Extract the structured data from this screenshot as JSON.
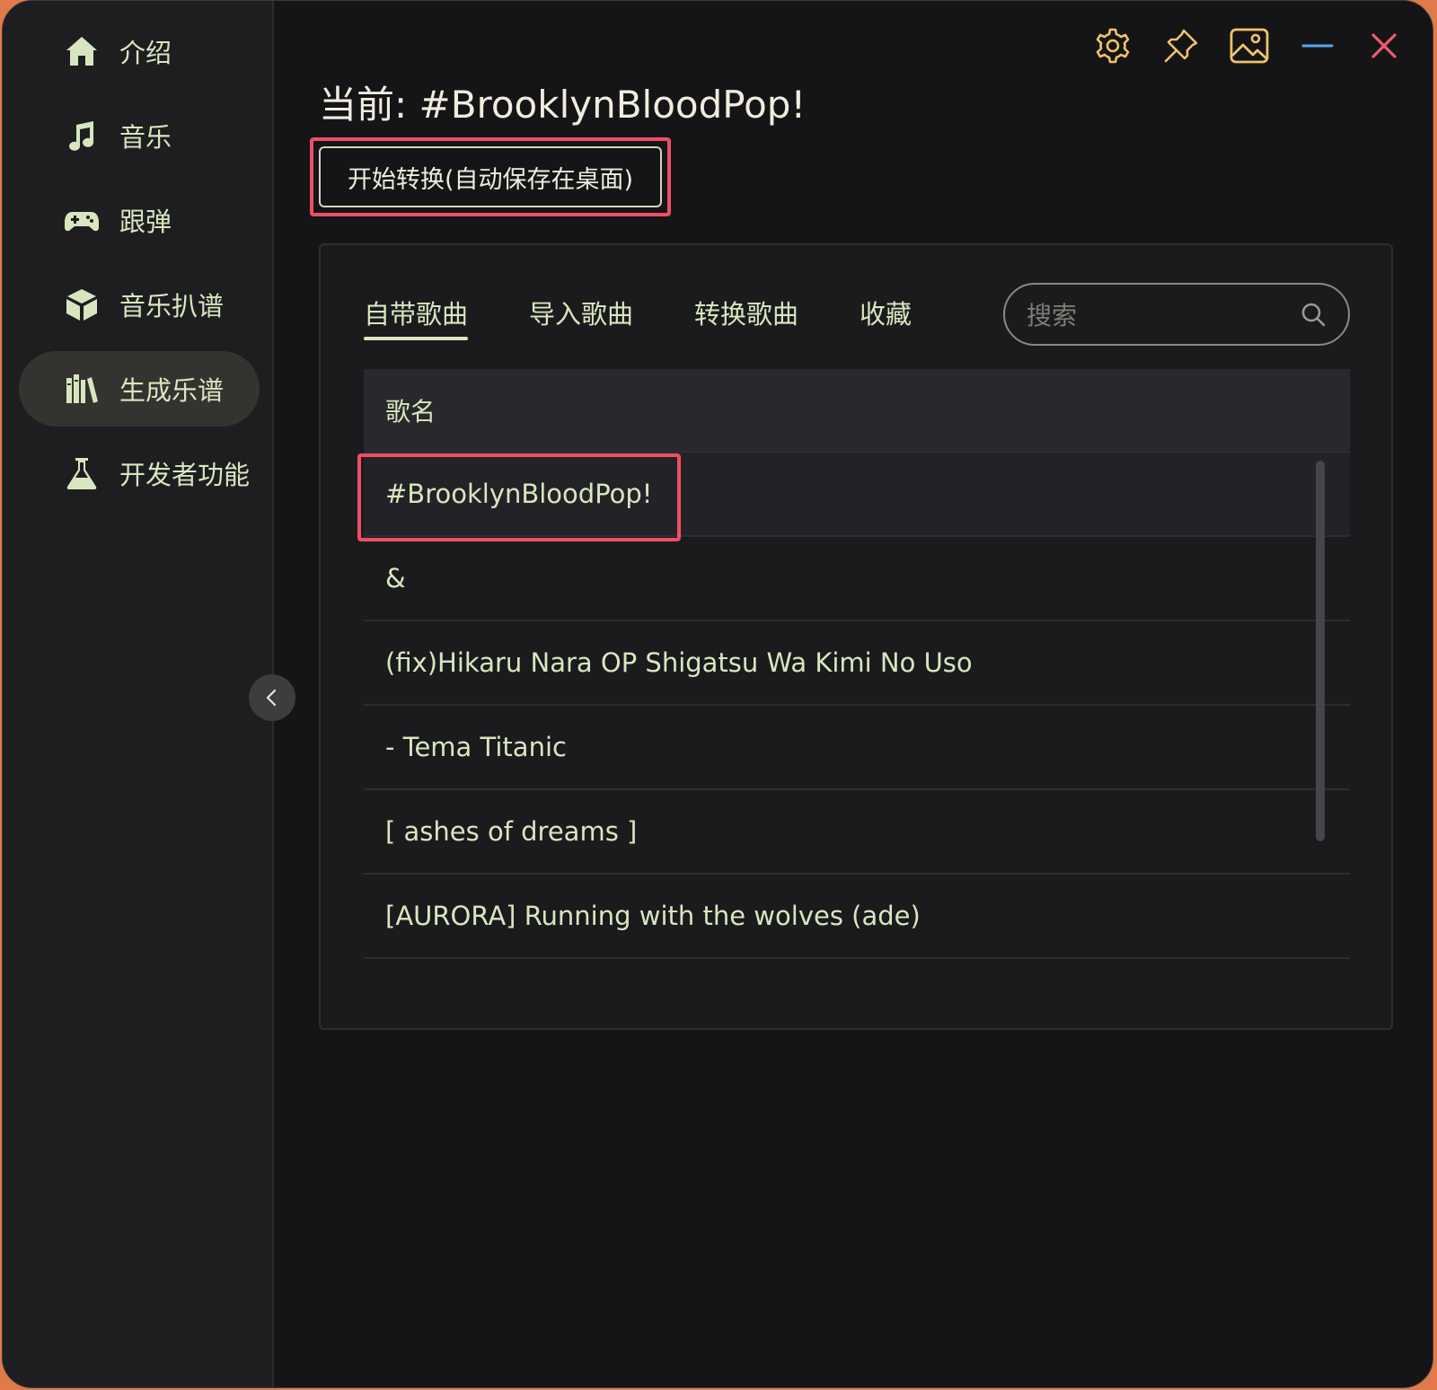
{
  "sidebar": {
    "items": [
      {
        "label": "介绍",
        "icon": "home-icon"
      },
      {
        "label": "音乐",
        "icon": "music-note-icon"
      },
      {
        "label": "跟弹",
        "icon": "gamepad-icon"
      },
      {
        "label": "音乐扒谱",
        "icon": "cube-icon"
      },
      {
        "label": "生成乐谱",
        "icon": "books-icon",
        "active": true
      },
      {
        "label": "开发者功能",
        "icon": "flask-icon"
      }
    ]
  },
  "titlebar": {
    "buttons": [
      "gear-icon",
      "pin-icon",
      "image-icon",
      "minimize-icon",
      "close-icon"
    ],
    "accent": "#f0c36a",
    "minimize_color": "#5aa6ef",
    "close_color": "#ee5a6e"
  },
  "main": {
    "title": "当前: #BrooklynBloodPop!",
    "convert_button": "开始转换(自动保存在桌面)",
    "tabs": [
      {
        "label": "自带歌曲",
        "active": true
      },
      {
        "label": "导入歌曲"
      },
      {
        "label": "转换歌曲"
      },
      {
        "label": "收藏"
      }
    ],
    "search": {
      "placeholder": "搜索"
    },
    "table": {
      "header": "歌名",
      "rows": [
        "#BrooklynBloodPop!",
        "&",
        "(fix)Hikaru Nara OP Shigatsu Wa Kimi No Uso",
        "- Tema Titanic",
        "[ ashes of dreams ]",
        "[AURORA] Running with the wolves (ade)"
      ],
      "selected_index": 0
    }
  },
  "colors": {
    "text": "#d8e6c0",
    "highlight": "#ee4f66",
    "background": "#151517"
  }
}
